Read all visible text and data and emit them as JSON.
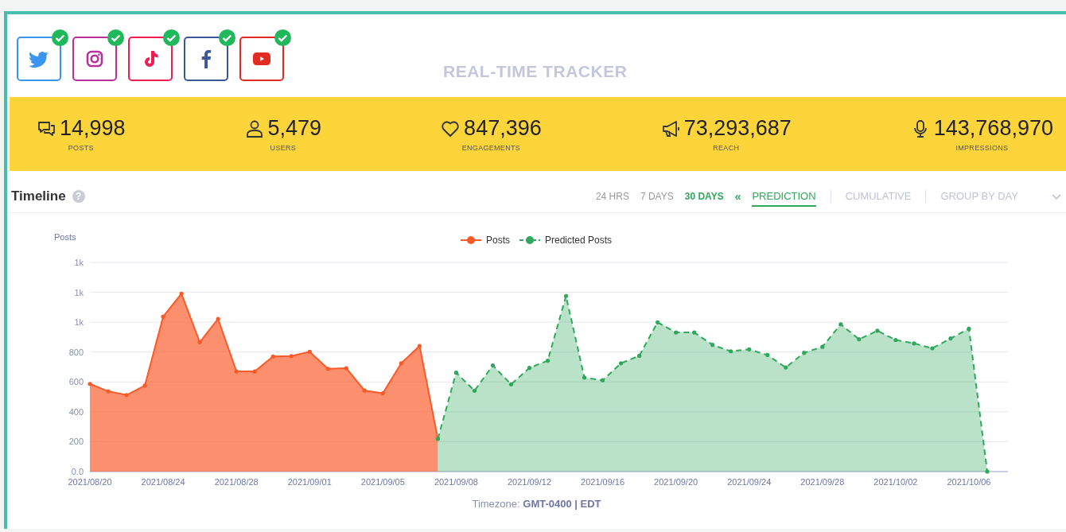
{
  "platforms": [
    {
      "kind": "twitter",
      "connected": true
    },
    {
      "kind": "instagram",
      "connected": true
    },
    {
      "kind": "tiktok",
      "connected": true
    },
    {
      "kind": "facebook",
      "connected": true
    },
    {
      "kind": "youtube",
      "connected": true
    }
  ],
  "title": "REAL-TIME TRACKER",
  "stats": [
    {
      "kind": "posts",
      "value": "14,998",
      "label": "POSTS"
    },
    {
      "kind": "users",
      "value": "5,479",
      "label": "USERS"
    },
    {
      "kind": "engagements",
      "value": "847,396",
      "label": "ENGAGEMENTS"
    },
    {
      "kind": "reach",
      "value": "73,293,687",
      "label": "REACH"
    },
    {
      "kind": "impressions",
      "value": "143,768,970",
      "label": "IMPRESSIONS"
    }
  ],
  "timeline": {
    "title": "Timeline",
    "help_icon": "?",
    "ranges": [
      {
        "label": "24 HRS",
        "selected": false
      },
      {
        "label": "7 DAYS",
        "selected": false
      },
      {
        "label": "30 DAYS",
        "selected": true
      }
    ],
    "collapse": "«",
    "modes": [
      {
        "label": "PREDICTION",
        "selected": true
      },
      {
        "label": "CUMULATIVE",
        "selected": false
      },
      {
        "label": "GROUP BY DAY",
        "selected": false
      }
    ],
    "chart_data": {
      "type": "area",
      "ylabel": "Posts",
      "grid": true,
      "legend": "top",
      "categories": [
        "2021/08/20",
        null,
        null,
        null,
        "2021/08/24",
        null,
        null,
        null,
        "2021/08/28",
        null,
        null,
        null,
        "2021/09/01",
        null,
        null,
        null,
        "2021/09/05",
        null,
        null,
        null,
        "2021/09/08",
        null,
        null,
        null,
        "2021/09/12",
        null,
        null,
        null,
        "2021/09/16",
        null,
        null,
        null,
        "2021/09/20",
        null,
        null,
        null,
        "2021/09/24",
        null,
        null,
        null,
        "2021/09/28",
        null,
        null,
        null,
        "2021/10/02",
        null,
        null,
        null,
        "2021/10/06",
        null
      ],
      "series": [
        {
          "name": "Posts",
          "color": "#fa5a2a",
          "values": [
            587,
            537,
            512,
            576,
            1037,
            1191,
            866,
            1022,
            670,
            670,
            770,
            773,
            802,
            688,
            692,
            542,
            524,
            725,
            841,
            220,
            null,
            null,
            null,
            null,
            null,
            null,
            null,
            null,
            null,
            null,
            null,
            null,
            null,
            null,
            null,
            null,
            null,
            null,
            null,
            null,
            null,
            null,
            null,
            null,
            null,
            null,
            null,
            null,
            null,
            null
          ]
        },
        {
          "name": "Predicted Posts",
          "color": "#2ea85a",
          "values": [
            null,
            null,
            null,
            null,
            null,
            null,
            null,
            null,
            null,
            null,
            null,
            null,
            null,
            null,
            null,
            null,
            null,
            null,
            null,
            219,
            662,
            541,
            710,
            584,
            694,
            742,
            1175,
            629,
            611,
            725,
            775,
            999,
            931,
            931,
            848,
            805,
            818,
            780,
            697,
            795,
            835,
            986,
            886,
            943,
            881,
            858,
            825,
            891,
            956,
            0
          ]
        }
      ],
      "ylim": [
        0,
        1400
      ],
      "yticks": [
        {
          "value": 0,
          "label": "0.0"
        },
        200,
        400,
        600,
        800,
        {
          "value": 1000,
          "label": "1k"
        },
        {
          "value": 1200,
          "label": "1k"
        },
        {
          "value": 1400,
          "label": "1k"
        }
      ]
    },
    "timezone_label": "Timezone:",
    "timezone": "GMT-0400 | EDT"
  }
}
